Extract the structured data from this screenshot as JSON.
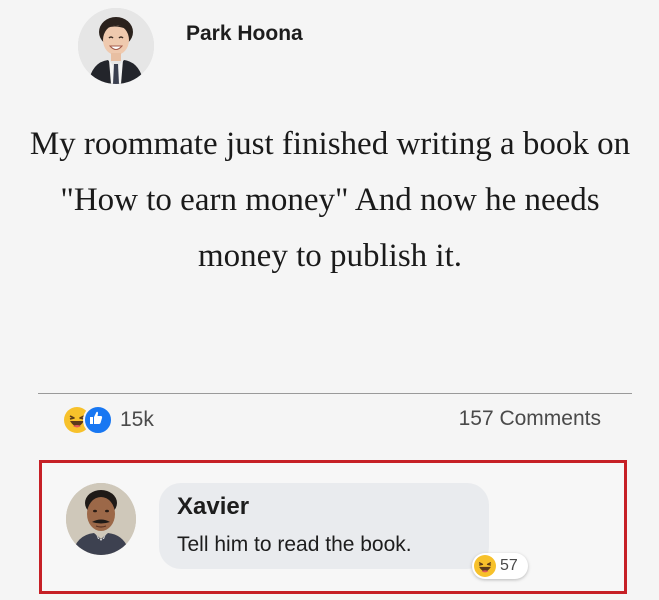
{
  "post": {
    "author": "Park Hoona",
    "text": "My roommate just finished writing a book on \"How to earn money\" And now he needs money to publish it.",
    "reaction_icons": [
      "haha-icon",
      "like-icon"
    ],
    "reaction_count": "15k",
    "comments_label": "157 Comments"
  },
  "comment": {
    "author": "Xavier",
    "text": "Tell him to read the book.",
    "reaction_icon": "haha-icon",
    "reaction_count": "57",
    "highlight_color": "#c62026"
  },
  "colors": {
    "like_blue": "#1877f2",
    "haha_yellow": "#f7c12b",
    "bubble_bg": "#e9ebee"
  }
}
